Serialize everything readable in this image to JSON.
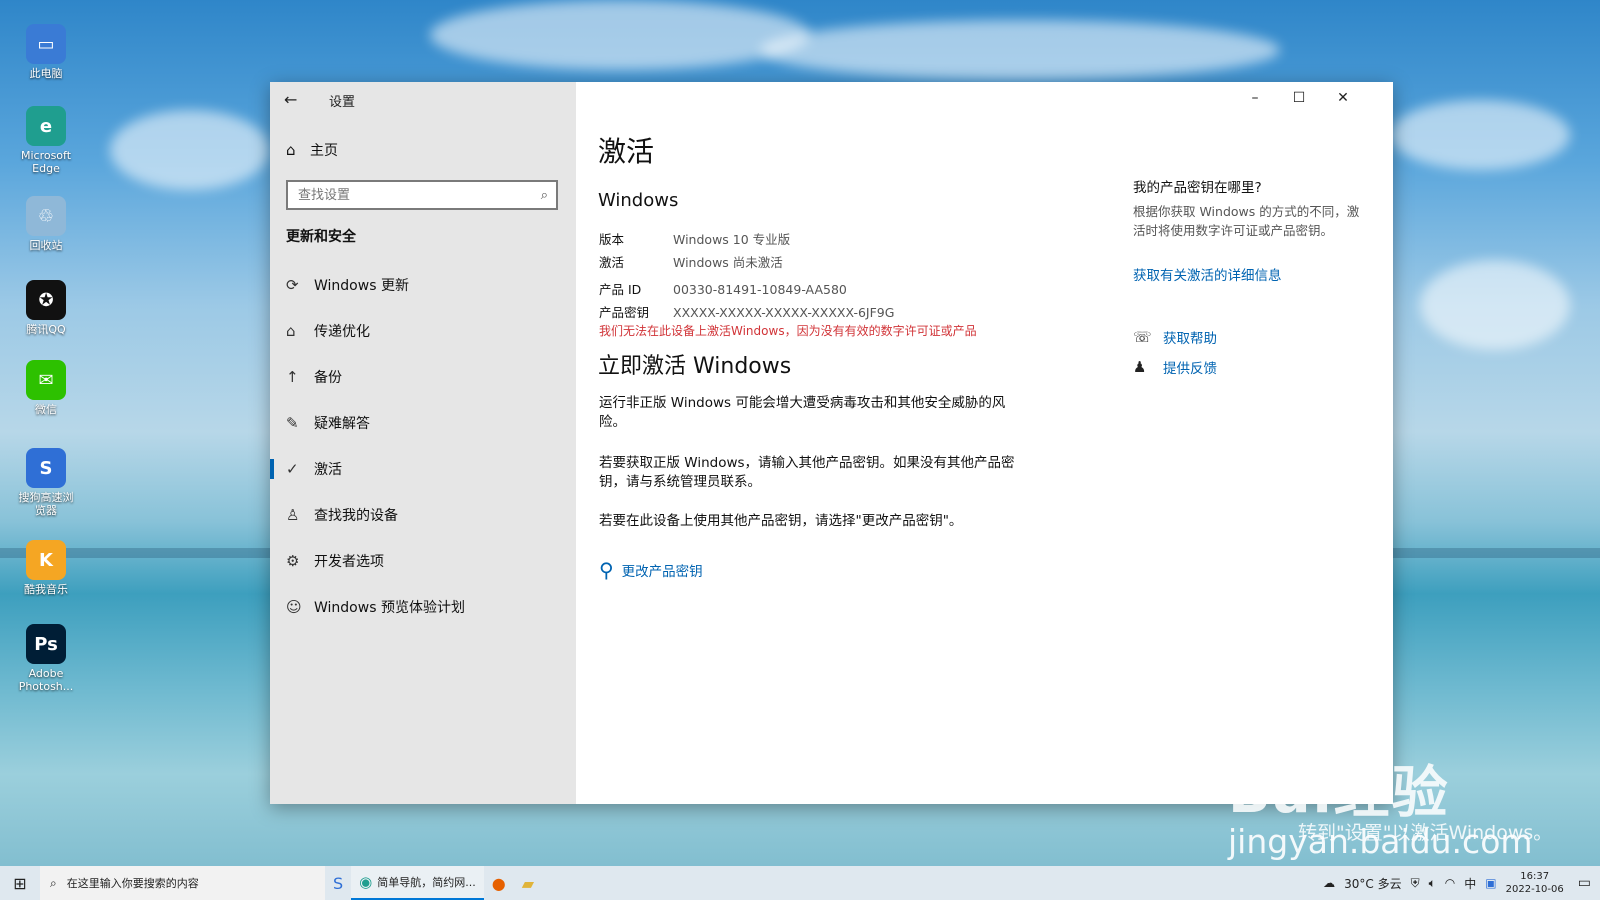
{
  "desktop": {
    "icons": [
      {
        "label": "此电脑",
        "icon": "computer-icon",
        "color": "#3a7bd5"
      },
      {
        "label": "Microsoft Edge",
        "icon": "edge-icon",
        "color": "#1f9e8f"
      },
      {
        "label": "回收站",
        "icon": "recycle-bin-icon",
        "color": "#8fb8d8"
      },
      {
        "label": "腾讯QQ",
        "icon": "qq-icon",
        "color": "#111111"
      },
      {
        "label": "微信",
        "icon": "wechat-icon",
        "color": "#2dc100"
      },
      {
        "label": "搜狗高速浏览器",
        "icon": "sogou-browser-icon",
        "color": "#2f6fd6"
      },
      {
        "label": "酷我音乐",
        "icon": "kuwo-music-icon",
        "color": "#f5a623"
      },
      {
        "label": "Adobe Photosh...",
        "icon": "photoshop-icon",
        "color": "#001e36"
      }
    ]
  },
  "window": {
    "app_title": "设置",
    "back_icon": "back-arrow-icon",
    "controls": {
      "minimize": "–",
      "maximize": "☐",
      "close": "✕"
    }
  },
  "sidebar": {
    "home_label": "主页",
    "search_placeholder": "查找设置",
    "section_title": "更新和安全",
    "items": [
      {
        "label": "Windows 更新",
        "icon": "sync-icon",
        "glyph": "⟳"
      },
      {
        "label": "传递优化",
        "icon": "delivery-optimization-icon",
        "glyph": "⌂"
      },
      {
        "label": "备份",
        "icon": "backup-icon",
        "glyph": "↑"
      },
      {
        "label": "疑难解答",
        "icon": "wrench-icon",
        "glyph": "✎"
      },
      {
        "label": "激活",
        "icon": "check-circle-icon",
        "glyph": "✓"
      },
      {
        "label": "查找我的设备",
        "icon": "person-location-icon",
        "glyph": "♙"
      },
      {
        "label": "开发者选项",
        "icon": "developer-icon",
        "glyph": "⚙"
      },
      {
        "label": "Windows 预览体验计划",
        "icon": "insider-icon",
        "glyph": "☺"
      }
    ],
    "active_index": 4
  },
  "main": {
    "title": "激活",
    "windows_heading": "Windows",
    "info": [
      {
        "key": "版本",
        "value": "Windows 10 专业版"
      },
      {
        "key": "激活",
        "value": "Windows 尚未激活"
      },
      {
        "key": "产品 ID",
        "value": "00330-81491-10849-AA580"
      },
      {
        "key": "产品密钥",
        "value": "XXXXX-XXXXX-XXXXX-XXXXX-6JF9G"
      }
    ],
    "error": "我们无法在此设备上激活Windows，因为没有有效的数字许可证或产品",
    "activate_heading": "立即激活 Windows",
    "para1": "运行非正版 Windows 可能会增大遭受病毒攻击和其他安全威胁的风险。",
    "para2": "若要获取正版 Windows，请输入其他产品密钥。如果没有其他产品密钥，请与系统管理员联系。",
    "para3": "若要在此设备上使用其他产品密钥，请选择\"更改产品密钥\"。",
    "change_key_label": "更改产品密钥"
  },
  "right_panel": {
    "title": "我的产品密钥在哪里?",
    "desc": "根据你获取 Windows 的方式的不同，激活时将使用数字许可证或产品密钥。",
    "link": "获取有关激活的详细信息",
    "help": "获取帮助",
    "feedback": "提供反馈"
  },
  "watermark": {
    "brand": "Bai经验",
    "caption": "转到\"设置\"以激活Windows。",
    "url": "jingyan.baidu.com"
  },
  "taskbar": {
    "search_text": "在这里输入你要搜索的内容",
    "open_app_label": "简单导航，简约网...",
    "weather": "30°C 多云",
    "ime": "中",
    "time": "16:37",
    "date": "2022-10-06"
  }
}
